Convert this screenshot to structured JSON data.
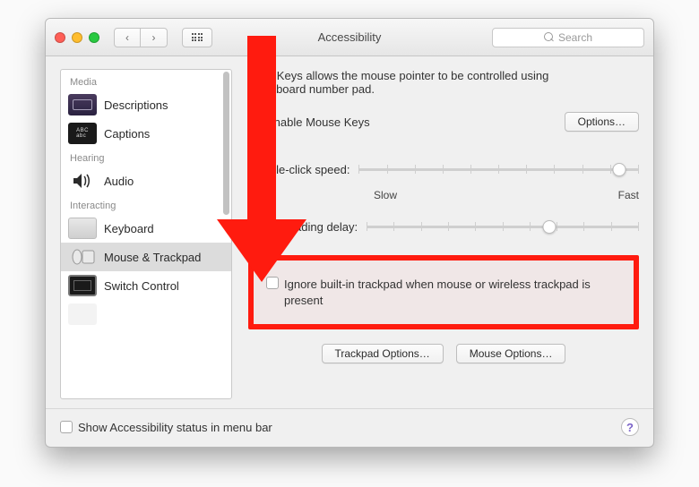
{
  "window": {
    "title": "Accessibility"
  },
  "search": {
    "placeholder": "Search"
  },
  "sidebar": {
    "groups": [
      {
        "label": "Media",
        "items": [
          {
            "label": "Descriptions",
            "icon": "descriptions-icon"
          },
          {
            "label": "Captions",
            "icon": "captions-icon"
          }
        ]
      },
      {
        "label": "Hearing",
        "items": [
          {
            "label": "Audio",
            "icon": "speaker-icon"
          }
        ]
      },
      {
        "label": "Interacting",
        "items": [
          {
            "label": "Keyboard",
            "icon": "keyboard-icon"
          },
          {
            "label": "Mouse & Trackpad",
            "icon": "mouse-icon",
            "selected": true
          },
          {
            "label": "Switch Control",
            "icon": "switch-icon"
          }
        ]
      }
    ]
  },
  "main": {
    "description_line1": "ouse Keys allows the mouse pointer to be controlled using",
    "description_line2": "e keyboard number pad.",
    "enable_mouse_keys_label": "Enable Mouse Keys",
    "options_button": "Options…",
    "double_click_label": "Double-click speed:",
    "spring_loading_label": "Spring-loading delay:",
    "slider_slow": "Slow",
    "slider_fast": "Fast",
    "ignore_trackpad": "Ignore built-in trackpad when mouse or wireless trackpad is present",
    "trackpad_options_button": "Trackpad Options…",
    "mouse_options_button": "Mouse Options…"
  },
  "footer": {
    "show_status_label": "Show Accessibility status in menu bar"
  },
  "sliders": {
    "double_click": 0.93,
    "spring_loading": 0.67
  }
}
